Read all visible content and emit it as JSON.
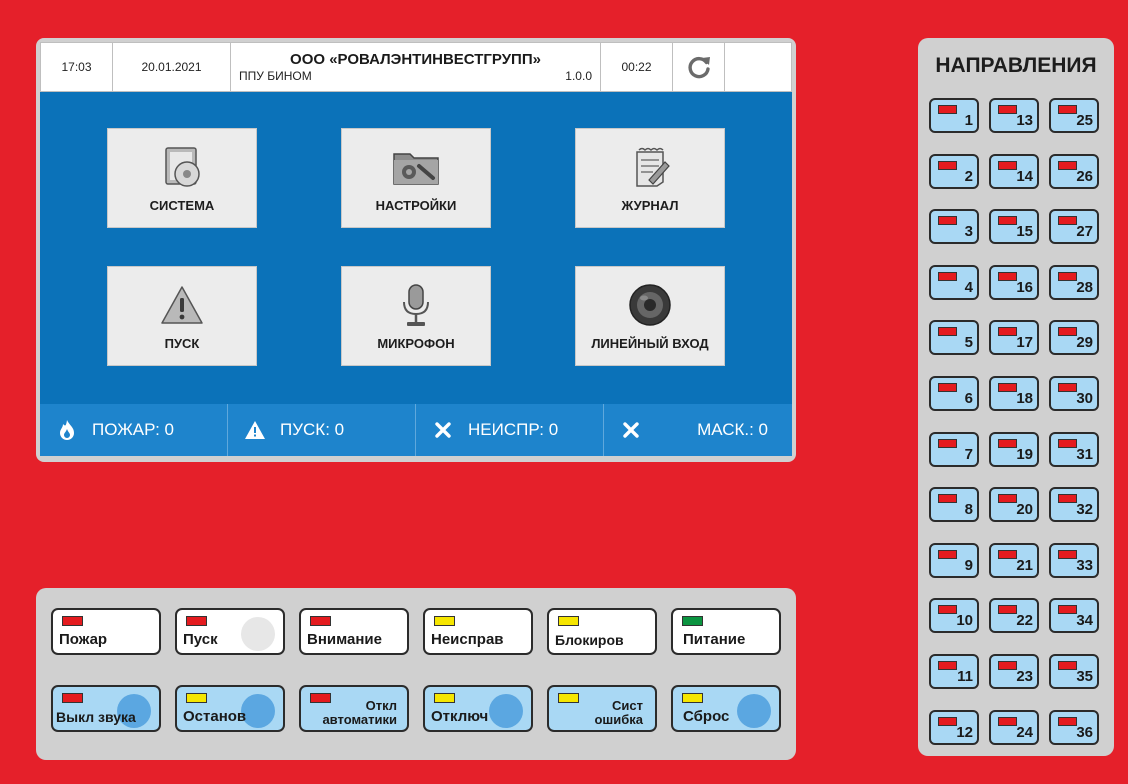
{
  "topbar": {
    "time": "17:03",
    "date": "20.01.2021",
    "org_name": "ООО «РОВАЛЭНТИНВЕСТГРУПП»",
    "device": "ППУ БИНОМ",
    "version": "1.0.0",
    "timer": "00:22",
    "refresh_icon": "refresh-icon"
  },
  "menu": [
    {
      "label": "СИСТЕМА",
      "icon": "system-icon"
    },
    {
      "label": "НАСТРОЙКИ",
      "icon": "settings-folder-icon"
    },
    {
      "label": "ЖУРНАЛ",
      "icon": "journal-icon"
    },
    {
      "label": "ПУСК",
      "icon": "warning-icon"
    },
    {
      "label": "МИКРОФОН",
      "icon": "microphone-icon"
    },
    {
      "label": "ЛИНЕЙНЫЙ ВХОД",
      "icon": "speaker-icon"
    }
  ],
  "status": [
    {
      "label": "ПОЖАР: 0",
      "icon": "fire-icon"
    },
    {
      "label": "ПУСК: 0",
      "icon": "warning-icon"
    },
    {
      "label": "НЕИСПР: 0",
      "icon": "close-icon"
    },
    {
      "label": "МАСК.: 0",
      "icon": "close-icon"
    }
  ],
  "buttons_row1": [
    {
      "label": "Пожар",
      "led": "red"
    },
    {
      "label": "Пуск",
      "led": "red"
    },
    {
      "label": "Внимание",
      "led": "red"
    },
    {
      "label": "Неисправ",
      "led": "yellow"
    },
    {
      "label": "Блокиров",
      "led": "yellow"
    },
    {
      "label": "Питание",
      "led": "green"
    }
  ],
  "buttons_row2": [
    {
      "label": "Выкл звука",
      "led": "red"
    },
    {
      "label": "Останов",
      "led": "yellow"
    },
    {
      "line1": "Откл",
      "line2": "автоматики",
      "led": "red"
    },
    {
      "label": "Отключ",
      "led": "yellow"
    },
    {
      "line1": "Сист",
      "line2": "ошибка",
      "led": "yellow"
    },
    {
      "label": "Сброс",
      "led": "yellow"
    }
  ],
  "directions": {
    "title": "НАПРАВЛЕНИЯ",
    "numbers": [
      "1",
      "2",
      "3",
      "4",
      "5",
      "6",
      "7",
      "8",
      "9",
      "10",
      "11",
      "12",
      "13",
      "14",
      "15",
      "16",
      "17",
      "18",
      "19",
      "20",
      "21",
      "22",
      "23",
      "24",
      "25",
      "26",
      "27",
      "28",
      "29",
      "30",
      "31",
      "32",
      "33",
      "34",
      "35",
      "36"
    ]
  },
  "colors": {
    "background": "#e5202a",
    "screen_blue": "#0b72b9",
    "status_blue": "#1e84cc",
    "button_blue": "#a9d8f4",
    "led_red": "#e41b1f",
    "led_yellow": "#f6e600",
    "led_green": "#0b9440"
  }
}
